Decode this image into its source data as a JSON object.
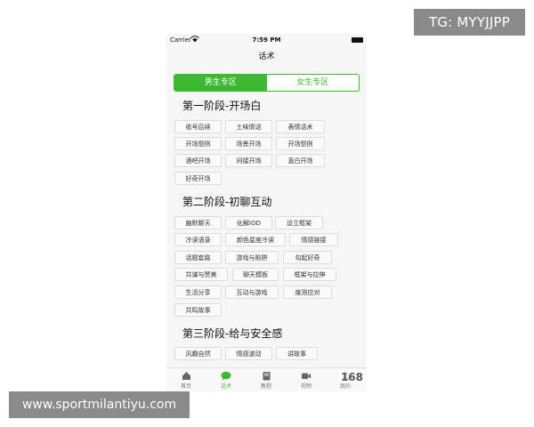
{
  "watermarks": {
    "top_right": "TG: MYYJJPP",
    "bottom_left": "www.sportmilantiyu.com"
  },
  "status_bar": {
    "carrier": "Carrier",
    "time": "7:59 PM"
  },
  "nav": {
    "title": "话术"
  },
  "segments": {
    "male": "男生专区",
    "female": "女生专区",
    "selected": "male"
  },
  "sections": [
    {
      "title": "第一阶段-开场白",
      "tags": [
        "收号后续",
        "土味情话",
        "表情话术",
        "开场惯例",
        "场景开场",
        "开场惯例",
        "酒吧开场",
        "间接开场",
        "直白开场",
        "好奇开场"
      ]
    },
    {
      "title": "第二阶段-初聊互动",
      "tags": [
        "幽默聊天",
        "化解IOD",
        "设立框架",
        "冷读语录",
        "颜色星座冷读",
        "情感链接",
        "话题套路",
        "游戏与陷阱",
        "勾起好奇",
        "共谋与赞美",
        "聊天模板",
        "框架与拉伸",
        "生活分享",
        "互动与游戏",
        "废测应对",
        "共鸣故事"
      ]
    },
    {
      "title": "第三阶段-给与安全感",
      "tags": [
        "风趣自然",
        "情感波动",
        "讲故事"
      ]
    }
  ],
  "tab_bar": {
    "items": [
      {
        "label": "首页",
        "icon": "home-icon"
      },
      {
        "label": "话术",
        "icon": "chat-bubble-icon"
      },
      {
        "label": "教程",
        "icon": "book-icon"
      },
      {
        "label": "视频",
        "icon": "video-icon"
      },
      {
        "label": "我的",
        "icon": "person-icon"
      }
    ],
    "active": "话术",
    "logo": "168"
  },
  "colors": {
    "accent": "#3cb831",
    "watermark_bg": "#8a8a8a"
  }
}
